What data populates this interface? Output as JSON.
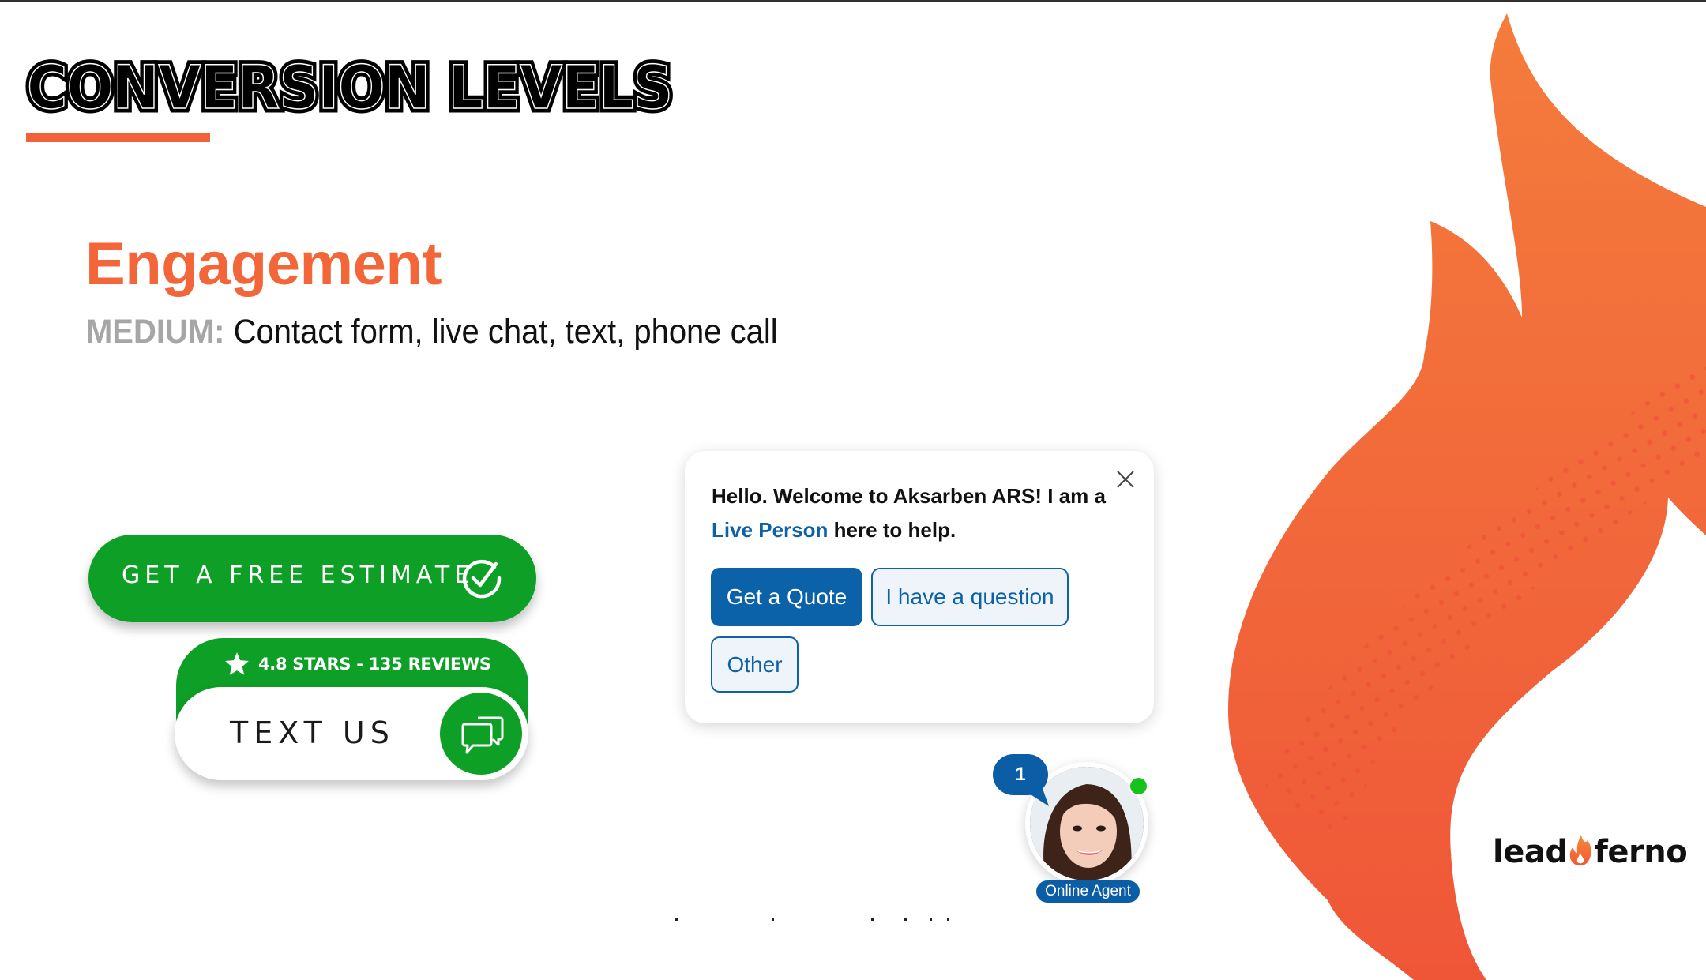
{
  "slide": {
    "title": "CONVERSION LEVELS",
    "section_title": "Engagement",
    "level_label": "MEDIUM:",
    "level_description": "Contact form, live chat, text, phone call",
    "colors": {
      "accent_orange": "#F2623A",
      "flame_top": "#F47B3C",
      "flame_bottom": "#EF5638",
      "cta_green": "#0E9F27",
      "chat_blue": "#0B62A8",
      "online_green": "#17C21C",
      "level_gray": "#A6A6A6"
    }
  },
  "estimate_button": {
    "label": "GET A FREE ESTIMATE",
    "icon": "check-circle-icon"
  },
  "text_us_widget": {
    "rating_text": "4.8 STARS - 135 REVIEWS",
    "rating_icon": "star-icon",
    "label": "TEXT US",
    "icon": "chat-bubbles-icon"
  },
  "chat_widget": {
    "message_prefix": "Hello. Welcome to Aksarben ARS! I am a ",
    "message_highlight": "Live Person",
    "message_suffix": " here to help.",
    "close_icon": "close-icon",
    "options": [
      {
        "label": "Get a Quote",
        "style": "primary"
      },
      {
        "label": "I have a question",
        "style": "secondary"
      },
      {
        "label": "Other",
        "style": "secondary"
      }
    ]
  },
  "agent_launcher": {
    "unread_count": "1",
    "status_label": "Online Agent",
    "status": "online"
  },
  "logo": {
    "left_text": "lead",
    "right_text": "ferno",
    "icon": "flame-icon"
  }
}
